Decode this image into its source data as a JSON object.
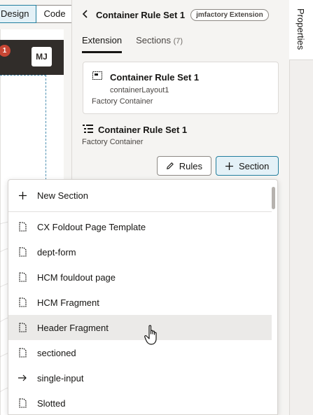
{
  "canvas": {
    "design_label": "Design",
    "code_label": "Code",
    "notification_count": "1",
    "avatar_initials": "MJ"
  },
  "panel": {
    "title": "Container Rule Set 1",
    "badge": "jmfactory Extension",
    "side_tab": "Properties",
    "tabs": [
      {
        "label": "Extension",
        "count": ""
      },
      {
        "label": "Sections",
        "count": "(7)"
      }
    ],
    "container": {
      "name": "Container Rule Set 1",
      "id": "containerLayout1",
      "type": "Factory Container"
    },
    "rule_set": {
      "name": "Container Rule Set 1",
      "type": "Factory Container"
    },
    "buttons": {
      "rules": "Rules",
      "section": "Section"
    }
  },
  "dropdown": {
    "new_section": "New Section",
    "items": [
      {
        "label": "CX Foldout Page Template",
        "icon": "page-icon"
      },
      {
        "label": "dept-form",
        "icon": "page-icon"
      },
      {
        "label": "HCM fouldout page",
        "icon": "page-icon"
      },
      {
        "label": "HCM Fragment",
        "icon": "page-icon"
      },
      {
        "label": "Header Fragment",
        "icon": "page-icon"
      },
      {
        "label": "sectioned",
        "icon": "page-icon"
      },
      {
        "label": "single-input",
        "icon": "arrow-right-icon"
      },
      {
        "label": "Slotted",
        "icon": "page-icon"
      }
    ],
    "hovered_item": "Header Fragment"
  }
}
